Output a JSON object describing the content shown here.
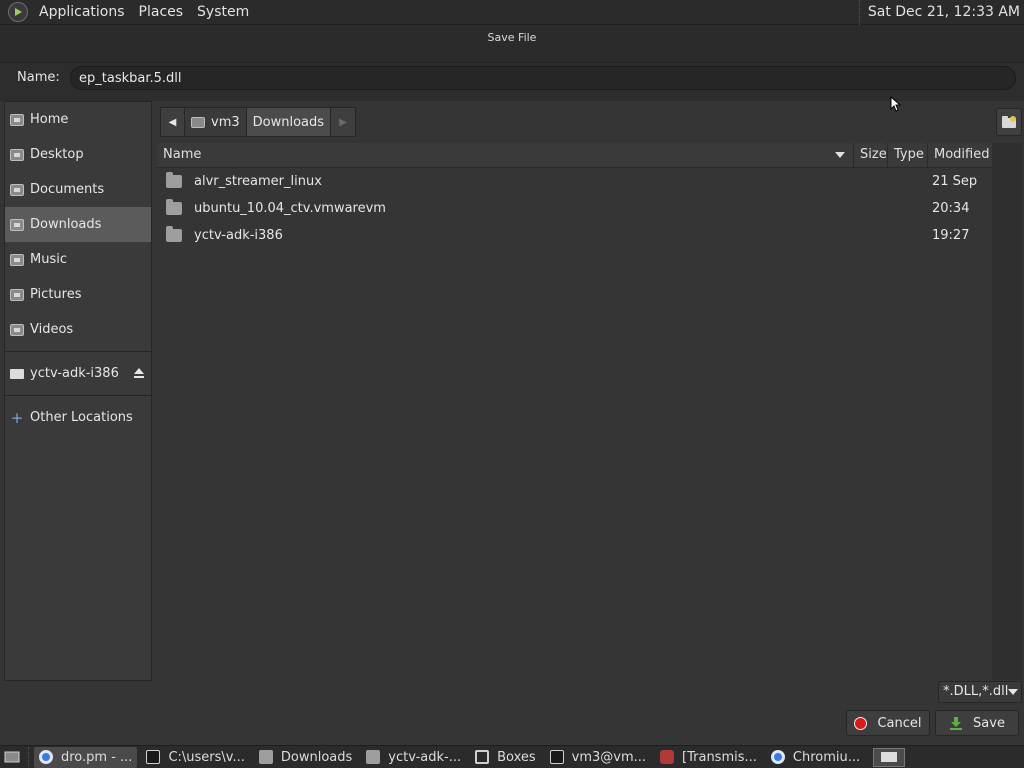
{
  "top_panel": {
    "menus": [
      "Applications",
      "Places",
      "System"
    ],
    "clock": "Sat Dec 21, 12:33 AM"
  },
  "dialog": {
    "title": "Save File",
    "name_label": "Name:",
    "name_value": "ep_taskbar.5.dll",
    "sidebar": {
      "places": [
        {
          "label": "Home",
          "icon": "home-folder-icon"
        },
        {
          "label": "Desktop",
          "icon": "desktop-folder-icon"
        },
        {
          "label": "Documents",
          "icon": "documents-folder-icon"
        },
        {
          "label": "Downloads",
          "icon": "downloads-folder-icon",
          "active": true
        },
        {
          "label": "Music",
          "icon": "music-folder-icon"
        },
        {
          "label": "Pictures",
          "icon": "pictures-folder-icon"
        },
        {
          "label": "Videos",
          "icon": "videos-folder-icon"
        }
      ],
      "devices": [
        {
          "label": "yctv-adk-i386",
          "icon": "drive-icon"
        }
      ],
      "other": {
        "label": "Other Locations",
        "icon": "plus-icon"
      }
    },
    "pathbar": {
      "segments": [
        "vm3",
        "Downloads"
      ]
    },
    "columns": {
      "name": "Name",
      "size": "Size",
      "type": "Type",
      "modified": "Modified"
    },
    "files": [
      {
        "name": "alvr_streamer_linux",
        "size": "",
        "type": "",
        "modified": "21 Sep"
      },
      {
        "name": "ubuntu_10.04_ctv.vmwarevm",
        "size": "",
        "type": "",
        "modified": "20:34"
      },
      {
        "name": "yctv-adk-i386",
        "size": "",
        "type": "",
        "modified": "19:27"
      }
    ],
    "filter": "*.DLL,*.dll",
    "cancel_label": "Cancel",
    "save_label": "Save"
  },
  "taskbar": {
    "items": [
      {
        "label": "dro.pm - ...",
        "icon": "chrome-icon",
        "active": true
      },
      {
        "label": "C:\\users\\v...",
        "icon": "terminal-icon"
      },
      {
        "label": "Downloads",
        "icon": "folder-icon"
      },
      {
        "label": "yctv-adk-...",
        "icon": "folder-icon"
      },
      {
        "label": "Boxes",
        "icon": "boxes-icon"
      },
      {
        "label": "vm3@vm...",
        "icon": "terminal-icon"
      },
      {
        "label": "[Transmis...",
        "icon": "transmission-icon"
      },
      {
        "label": "Chromiu...",
        "icon": "chrome-icon"
      }
    ]
  },
  "colors": {
    "cancel_red": "#d91a1a",
    "save_green": "#5fae4a",
    "selection": "#5b5b5b"
  }
}
